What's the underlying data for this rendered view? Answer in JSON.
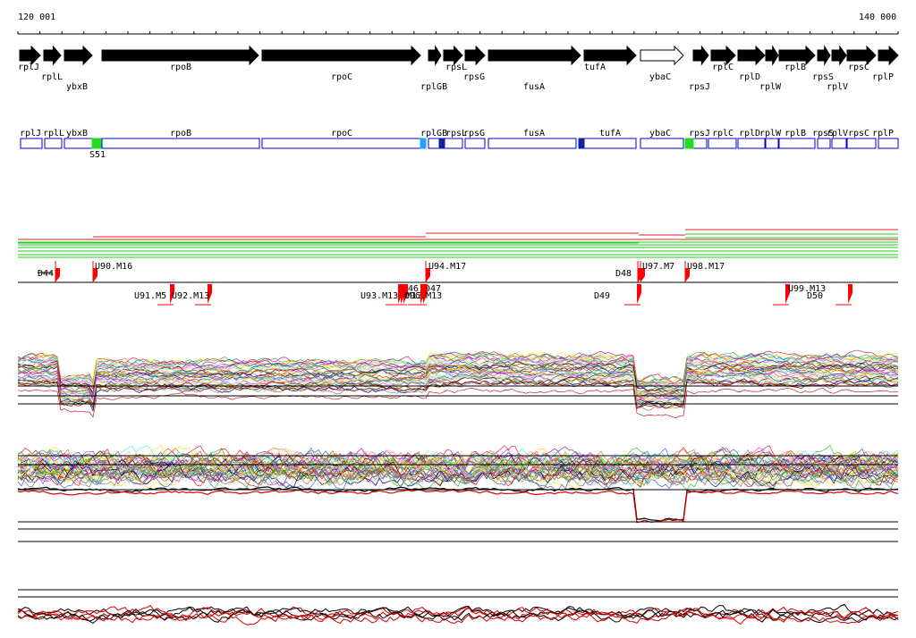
{
  "ruler": {
    "start_label": "120 001",
    "end_label": "140 000"
  },
  "genes_track": {
    "genes": [
      {
        "name": "rplJ",
        "strand": "+"
      },
      {
        "name": "rplL",
        "strand": "+"
      },
      {
        "name": "ybxB",
        "strand": "+"
      },
      {
        "name": "rpoB",
        "strand": "+"
      },
      {
        "name": "rpoC",
        "strand": "+"
      },
      {
        "name": "rplGB",
        "strand": "+"
      },
      {
        "name": "rpsL",
        "strand": "+"
      },
      {
        "name": "rpsG",
        "strand": "+"
      },
      {
        "name": "fusA",
        "strand": "+"
      },
      {
        "name": "tufA",
        "strand": "+"
      },
      {
        "name": "ybaC",
        "strand": "+",
        "hollow": true
      },
      {
        "name": "rpsJ",
        "strand": "+"
      },
      {
        "name": "rplC",
        "strand": "+"
      },
      {
        "name": "rplD",
        "strand": "+"
      },
      {
        "name": "rplW",
        "strand": "+"
      },
      {
        "name": "rplB",
        "strand": "+"
      },
      {
        "name": "rpsS",
        "strand": "+"
      },
      {
        "name": "rplV",
        "strand": "+"
      },
      {
        "name": "rpsC",
        "strand": "+"
      },
      {
        "name": "rplP",
        "strand": "+"
      }
    ]
  },
  "box_track": {
    "genes": [
      {
        "name": "rplJ"
      },
      {
        "name": "rplL"
      },
      {
        "name": "ybxB"
      },
      {
        "name": "rpoB"
      },
      {
        "name": "rpoC"
      },
      {
        "name": "rplGB"
      },
      {
        "name": "rpsL"
      },
      {
        "name": "rpsG"
      },
      {
        "name": "fusA"
      },
      {
        "name": "tufA"
      },
      {
        "name": "ybaC"
      },
      {
        "name": "rpsJ"
      },
      {
        "name": "rplC"
      },
      {
        "name": "rplD"
      },
      {
        "name": "rplW"
      },
      {
        "name": "rplB"
      },
      {
        "name": "rpsS"
      },
      {
        "name": "rplV"
      },
      {
        "name": "rpsC"
      },
      {
        "name": "rplP"
      }
    ],
    "features": [
      {
        "label": "S51",
        "color": "#22dd22"
      },
      {
        "label": "",
        "color": "#22a0ff"
      },
      {
        "label": "",
        "color": "#1020a0"
      },
      {
        "label": "",
        "color": "#1020a0"
      },
      {
        "label": "",
        "color": "#22dd22"
      }
    ]
  },
  "markers": {
    "top": [
      "D44",
      "U90.M16",
      "U94.M17",
      "D48",
      "U97.M7",
      "U98.M17"
    ],
    "bottom": [
      "U91.M5",
      "U92.M13",
      "U93.M13",
      "D46",
      "M13",
      "D47",
      "U96.M13",
      "D49",
      "U99.M13",
      "D50"
    ]
  },
  "colors": {
    "gene_fill": "#000000",
    "box_stroke": "#0000cc",
    "marker": "#ff0000",
    "track_red": "#dd2222",
    "track_green": "#22cc22"
  }
}
